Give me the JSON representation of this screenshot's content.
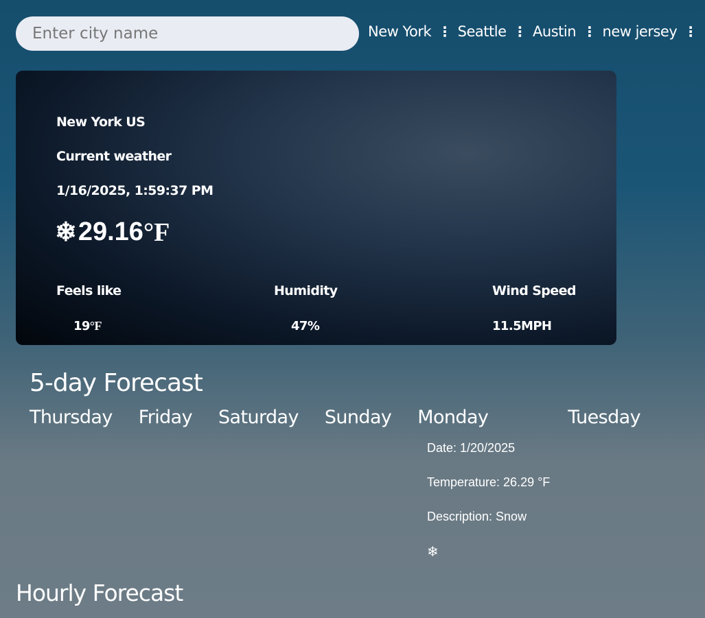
{
  "search": {
    "placeholder": "Enter city name"
  },
  "saved_cities": [
    "New York",
    "Seattle",
    "Austin",
    "new jersey"
  ],
  "current": {
    "location": "New York US",
    "heading": "Current weather",
    "datetime": "1/16/2025, 1:59:37 PM",
    "icon": "snowflake-icon",
    "temperature": "29.16",
    "unit": "°F",
    "feels_like_label": "Feels like",
    "feels_like": "19",
    "feels_like_unit": "°F",
    "humidity_label": "Humidity",
    "humidity": "47%",
    "wind_label": "Wind Speed",
    "wind": "11.5MPH"
  },
  "forecast": {
    "title": "5-day Forecast",
    "days": [
      "Thursday",
      "Friday",
      "Saturday",
      "Sunday",
      "Monday",
      "Tuesday"
    ],
    "selected": {
      "date": "Date: 1/20/2025",
      "temperature": "Temperature: 26.29 °F",
      "description": "Description: Snow",
      "icon": "snowflake-icon",
      "icon_glyph": "❄"
    }
  },
  "hourly": {
    "title": "Hourly Forecast"
  }
}
